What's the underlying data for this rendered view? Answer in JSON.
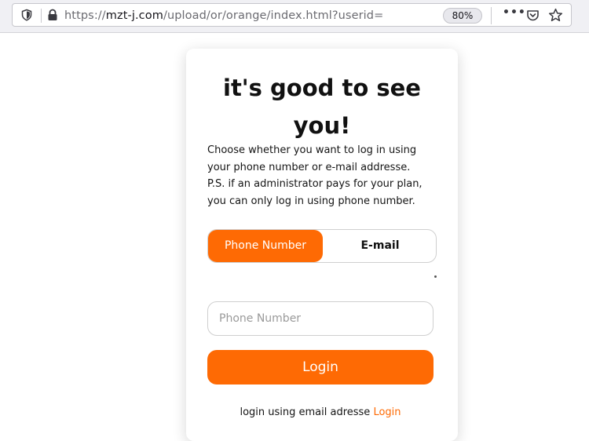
{
  "browser": {
    "url_prefix": "https://",
    "url_host": "mzt-j.com",
    "url_path": "/upload/or/orange/index.html?userid=",
    "zoom": "80%",
    "more_label": "•••"
  },
  "card": {
    "title_line1": "it's good to see",
    "title_line2": "you!",
    "description_lines": [
      "Choose whether you want to log in using",
      "your phone number or e-mail addresse.",
      "P.S. if an administrator pays for your plan,",
      "you can only log in using phone number."
    ],
    "toggle": {
      "phone_label": "Phone Number",
      "email_label": "E-mail",
      "selected": "Phone Number"
    },
    "phone_input": {
      "placeholder": "Phone Number",
      "value": ""
    },
    "login_button": "Login",
    "alt_text": "login using email adresse",
    "alt_link": "Login"
  },
  "colors": {
    "accent": "#fe6a04",
    "text": "#111111",
    "border": "#cfcfcf"
  },
  "icons": [
    "shield-icon",
    "lock-icon",
    "pocket-icon",
    "star-icon",
    "more-icon"
  ]
}
